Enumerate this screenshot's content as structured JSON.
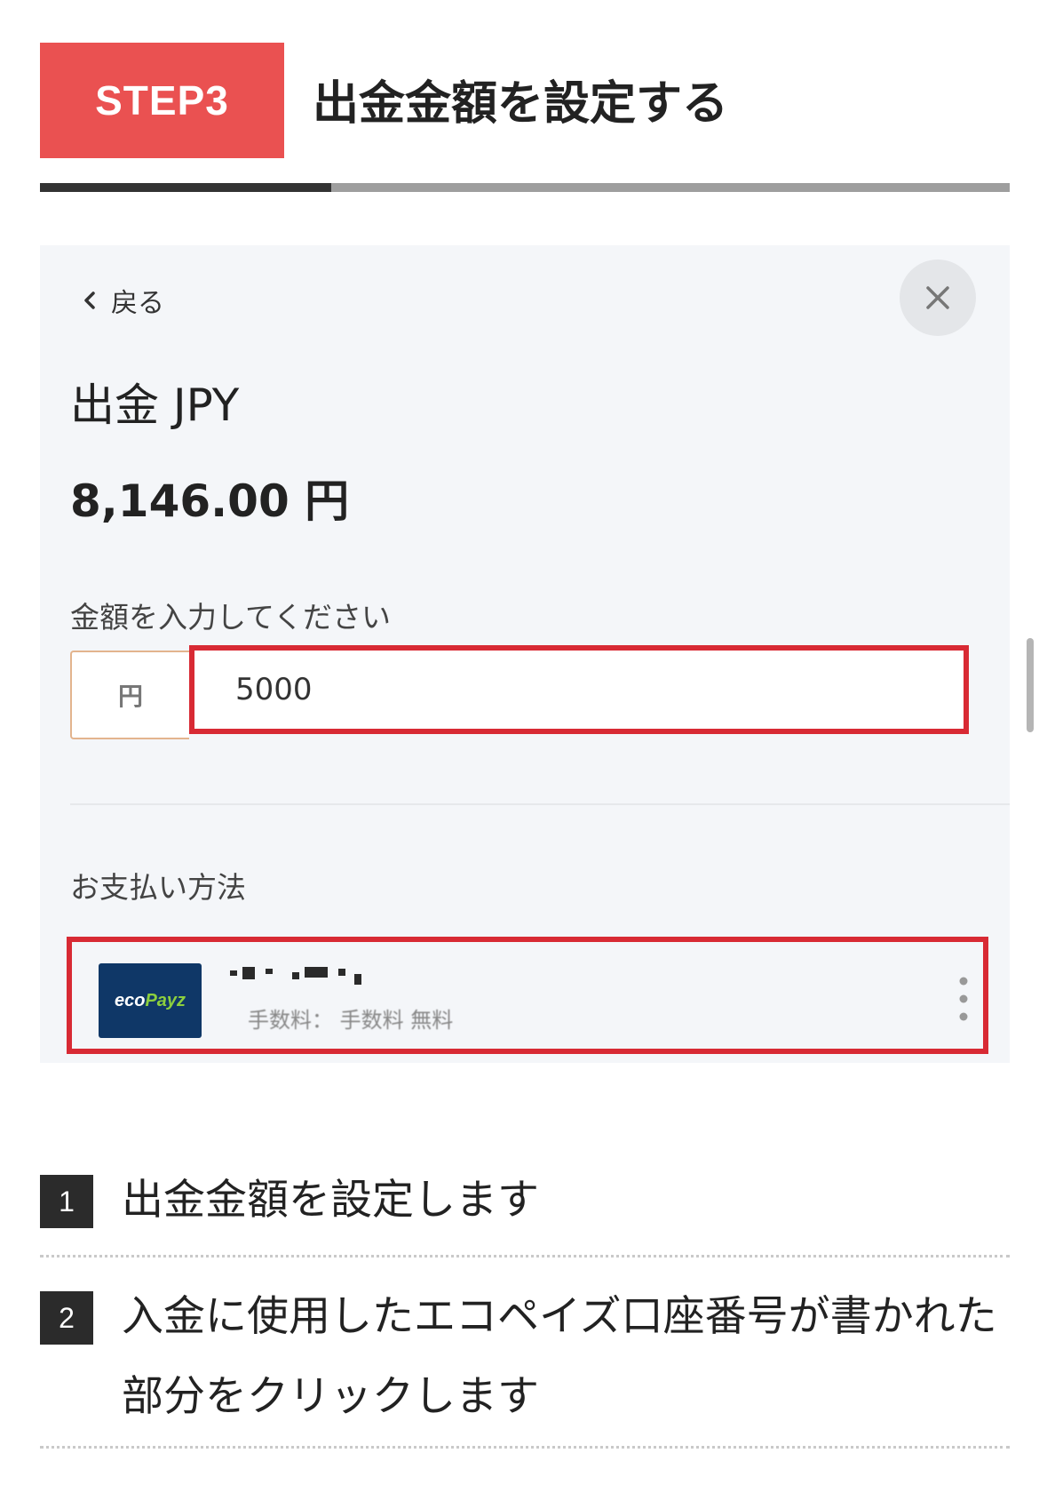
{
  "step": {
    "badge": "STEP3",
    "title": "出金金額を設定する",
    "progress": 0.3,
    "colors": {
      "badge": "#ea5151",
      "bar": "#9e9e9e",
      "bar_fill": "#333333"
    }
  },
  "panel": {
    "back_label": "戻る",
    "withdraw_title": "出金 JPY",
    "balance": "8,146.00 円",
    "amount_label": "金額を入力してください",
    "currency": "円",
    "amount_value": "5000",
    "payment_label": "お支払い方法",
    "method": {
      "logo_left": "eco",
      "logo_right": "Payz",
      "fee": "手数料： 手数料 無料"
    },
    "highlight_color": "#d82a34"
  },
  "instructions": [
    {
      "num": "1",
      "text": "出金金額を設定します"
    },
    {
      "num": "2",
      "text": "入金に使用したエコペイズ口座番号が書かれた部分をクリックします"
    }
  ]
}
